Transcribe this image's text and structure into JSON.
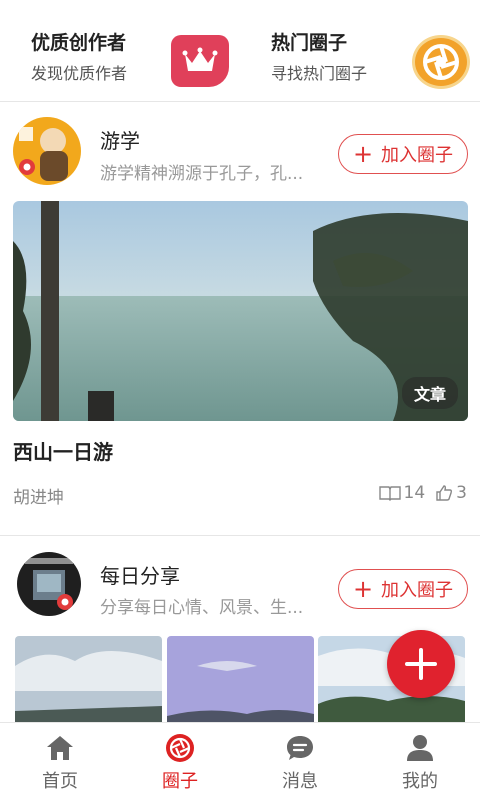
{
  "promos": [
    {
      "title": "优质创作者",
      "subtitle": "发现优质作者",
      "icon": "crown-icon"
    },
    {
      "title": "热门圈子",
      "subtitle": "寻找热门圈子",
      "icon": "aperture-icon"
    }
  ],
  "circles": [
    {
      "name": "游学",
      "description": "游学精神溯源于孔子，孔...",
      "join_label": "加入圈子",
      "post": {
        "type_badge": "文章",
        "title": "西山一日游",
        "author": "胡进坤",
        "reads": "14",
        "likes": "3"
      }
    },
    {
      "name": "每日分享",
      "description": "分享每日心情、风景、生...",
      "join_label": "加入圈子"
    }
  ],
  "tabs": [
    {
      "label": "首页",
      "icon": "home-icon",
      "active": false
    },
    {
      "label": "圈子",
      "icon": "aperture-icon",
      "active": true
    },
    {
      "label": "消息",
      "icon": "chat-bubble-icon",
      "active": false
    },
    {
      "label": "我的",
      "icon": "person-icon",
      "active": false
    }
  ],
  "colors": {
    "accent": "#d22222",
    "fab": "#e0222e",
    "crown_tile": "#e0405a",
    "aperture_tile": "#f2a22a"
  }
}
